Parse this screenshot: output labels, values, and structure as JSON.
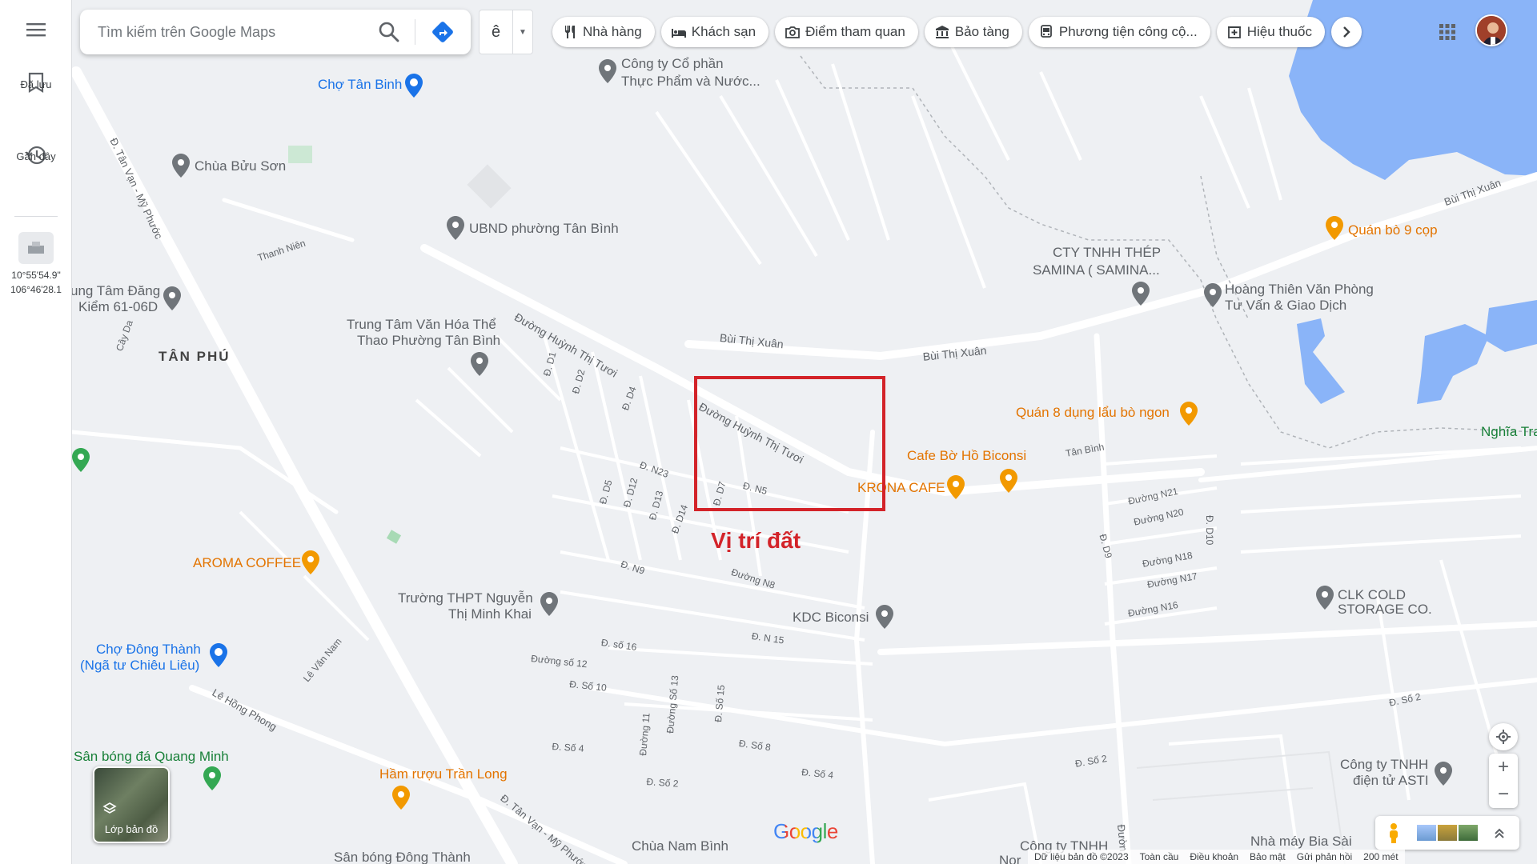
{
  "rail": {
    "menu_icon": "hamburger-icon",
    "saved_label": "Đã lưu",
    "recent_label": "Gần đây",
    "coord_lat": "10°55'54.9\"",
    "coord_lng": "106°46'28.1"
  },
  "search": {
    "placeholder": "Tìm kiếm trên Google Maps",
    "language_value": "ê"
  },
  "chips": [
    {
      "label": "Nhà hàng",
      "icon": "fork-knife-icon"
    },
    {
      "label": "Khách sạn",
      "icon": "bed-icon"
    },
    {
      "label": "Điểm tham quan",
      "icon": "camera-icon"
    },
    {
      "label": "Bảo tàng",
      "icon": "museum-icon"
    },
    {
      "label": "Phương tiện công cộ...",
      "icon": "bus-icon"
    },
    {
      "label": "Hiệu thuốc",
      "icon": "pharmacy-icon"
    }
  ],
  "pois": {
    "cho_tan_binh": "Chợ Tân Binh",
    "cty_thuc_pham_1": "Công ty Cổ phần",
    "cty_thuc_pham_2": "Thực Phẩm và Nước...",
    "chua_buu_son": "Chùa Bửu Sơn",
    "ubnd": "UBND phường Tân Bình",
    "dang_kiem_1": "ung Tâm Đăng",
    "dang_kiem_2": "Kiểm 61-06D",
    "tan_phu": "TÂN PHÚ",
    "trung_tam_1": "Trung Tâm Văn Hóa Thể",
    "trung_tam_2": "Thao Phường Tân Bình",
    "cty_thep_1": "CTY TNHH THÉP",
    "cty_thep_2": "SAMINA ( SAMINA...",
    "hoang_thien_1": "Hoàng Thiên Văn Phòng",
    "hoang_thien_2": "Tư Vấn & Giao Dịch",
    "quan_bo": "Quán bò 9 cọp",
    "quan_8": "Quán 8 dụng lẩu bò ngon",
    "cafe_bo_ho": "Cafe Bờ Hồ Biconsi",
    "krona": "KRONA CAFE",
    "nghia_tra": "Nghĩa Tra",
    "aroma": "AROMA COFFEE",
    "thpt_1": "Trường THPT Nguyễn",
    "thpt_2": "Thị Minh Khai",
    "kdc": "KDC Biconsi",
    "clk_1": "CLK COLD",
    "clk_2": "STORAGE CO.",
    "cho_dong_thanh_1": "Chợ Đông Thành",
    "cho_dong_thanh_2": "(Ngã tư Chiêu Liêu)",
    "san_bong_qm": "Sân bóng đá Quang Minh",
    "ham_ruou": "Hầm rượu Trần Long",
    "astl_1": "Công ty TNHH",
    "astl_2": "điện tử ASTI",
    "chua_nam_binh": "Chùa Nam Bình",
    "san_bong_dt": "Sân bóng Đông Thành",
    "cong_ty_tnhh": "Công ty TNHH",
    "nha_may_bia": "Nhà máy Bia Sài",
    "nor": "Nor"
  },
  "roads": {
    "tan_van_my_phuoc": "Đ. Tân Vạn - Mỹ Phước",
    "thanh_nien": "Thanh Niên",
    "huynh_thi_tuoi_1": "Đường Huỳnh Thị Tươi",
    "huynh_thi_tuoi_2": "Đường Huỳnh Thị Tươi",
    "bui_thi_xuan_1": "Bùi Thị Xuân",
    "bui_thi_xuan_2": "Bùi Thị Xuân",
    "bui_thi_xuan_3": "Bùi Thị Xuân",
    "cay_da": "Cây Da",
    "d1": "Đ. D1",
    "d2": "Đ. D2",
    "d4": "Đ. D4",
    "d5": "Đ. D5",
    "d7": "Đ. D7",
    "d12": "Đ. D12",
    "d13": "Đ. D13",
    "d14": "Đ. D14",
    "n5": "Đ. N5",
    "n23": "Đ. N23",
    "n9": "Đ. N9",
    "n8": "Đường N8",
    "n15": "Đ. N 15",
    "tan_binh": "Tân Bình",
    "n21": "Đường N21",
    "n20": "Đường N20",
    "n18": "Đường N18",
    "n17": "Đường N17",
    "n16": "Đường N16",
    "d9": "Đ. D9",
    "d10": "Đ. D10",
    "so16": "Đ. số 16",
    "so12": "Đường số 12",
    "so10": "Đ. Số 10",
    "so13": "Đường Số 13",
    "so15": "Đ. Số 15",
    "so11": "Đường 11",
    "so8": "Đ. Số 8",
    "so4a": "Đ. Số 4",
    "so4b": "Đ. Số 4",
    "so2a": "Đ. Số 2",
    "so2b": "Đ. Số 2",
    "so2c": "Đ. Số 2",
    "le_van_nam": "Lê Văn Nam",
    "le_hong_phong": "Lê Hồng Phong",
    "tan_van_2": "Đ. Tân Vạn - Mỹ Phước",
    "duong_bottom": "Đườn"
  },
  "highlight": {
    "label": "Vị trí đất",
    "color": "#d32329"
  },
  "controls": {
    "layers_label": "Lớp bản đồ",
    "zoom_in": "+",
    "zoom_out": "−"
  },
  "footer": {
    "copyright": "Dữ liệu bản đồ ©2023",
    "global": "Toàn cầu",
    "terms": "Điều khoản",
    "privacy": "Bảo mật",
    "feedback": "Gửi phản hồi",
    "scale": "200 mét"
  },
  "brand": {
    "google": "Google"
  },
  "colors": {
    "water": "#8ab4f8",
    "road": "#ffffff",
    "land": "#eef0f3",
    "accent": "#1a73e8"
  }
}
